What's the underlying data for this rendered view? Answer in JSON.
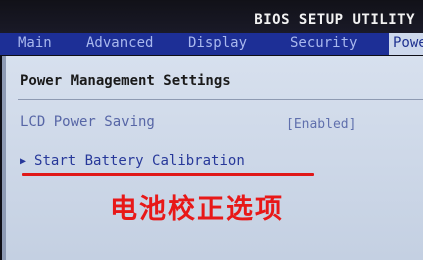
{
  "header": {
    "title": "BIOS SETUP UTILITY"
  },
  "tabs": [
    {
      "label": "Main"
    },
    {
      "label": "Advanced"
    },
    {
      "label": "Display"
    },
    {
      "label": "Security"
    },
    {
      "label": "Powe"
    }
  ],
  "content": {
    "section_title": "Power Management Settings",
    "items": [
      {
        "label": "LCD Power Saving",
        "value": "[Enabled]"
      }
    ],
    "submenu": {
      "label": "Start Battery Calibration"
    }
  },
  "annotation": {
    "text": "电池校正选项",
    "color": "#e81818"
  },
  "colors": {
    "tab_bar": "#1d2f96",
    "panel": "#d7e0ee",
    "active_tab": "#cdd8ec"
  }
}
